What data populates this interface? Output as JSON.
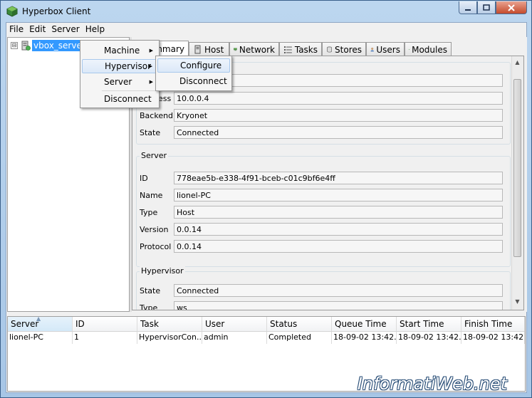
{
  "window": {
    "title": "Hyperbox Client"
  },
  "menubar": [
    {
      "label": "File",
      "name": "menu-file"
    },
    {
      "label": "Edit",
      "name": "menu-edit"
    },
    {
      "label": "Server",
      "name": "menu-server"
    },
    {
      "label": "Help",
      "name": "menu-help"
    }
  ],
  "tree": {
    "expander": "⊟",
    "server_label": "vbox_server"
  },
  "tabs": [
    {
      "label": "Summary",
      "name": "tab-summary",
      "icon": "summary-icon",
      "active": true
    },
    {
      "label": "Host",
      "name": "tab-host",
      "icon": "host-icon"
    },
    {
      "label": "Network",
      "name": "tab-network",
      "icon": "network-icon"
    },
    {
      "label": "Tasks",
      "name": "tab-tasks",
      "icon": "tasks-icon"
    },
    {
      "label": "Stores",
      "name": "tab-stores",
      "icon": "stores-icon"
    },
    {
      "label": "Users",
      "name": "tab-users",
      "icon": "users-icon"
    },
    {
      "label": "Modules",
      "name": "tab-modules",
      "icon": "modules-icon"
    }
  ],
  "summary": {
    "connection": {
      "address_label_partial": "ess",
      "address": "10.0.0.4",
      "backend_label": "Backend",
      "backend": "Kryonet",
      "state_label": "State",
      "state": "Connected"
    },
    "server": {
      "title": "Server",
      "id_label": "ID",
      "id": "778eae5b-e338-4f91-bceb-c01c9bf6e4ff",
      "name_label": "Name",
      "name": "lionel-PC",
      "type_label": "Type",
      "type": "Host",
      "version_label": "Version",
      "version": "0.0.14",
      "protocol_label": "Protocol",
      "protocol": "0.0.14"
    },
    "hypervisor": {
      "title": "Hypervisor",
      "state_label": "State",
      "state": "Connected",
      "type_label": "Type",
      "type": "ws"
    }
  },
  "context_menu": {
    "items": [
      {
        "label": "Machine",
        "submenu": true
      },
      {
        "label": "Hypervisor",
        "submenu": true,
        "highlighted": true
      },
      {
        "label": "Server",
        "submenu": true
      },
      {
        "label": "Disconnect",
        "submenu": false
      }
    ],
    "submenu_items": [
      {
        "label": "Configure",
        "highlighted": true
      },
      {
        "label": "Disconnect"
      }
    ]
  },
  "tasks_table": {
    "columns": [
      "Server",
      "ID",
      "Task",
      "User",
      "Status",
      "Queue Time",
      "Start Time",
      "Finish Time"
    ],
    "rows": [
      [
        "lionel-PC",
        "1",
        "HypervisorCon...",
        "admin",
        "Completed",
        "18-09-02 13:42...",
        "18-09-02 13:42...",
        "18-09-02 13:42..."
      ]
    ]
  },
  "watermark": "InformatiWeb.net",
  "colors": {
    "selection": "#3399ff",
    "title_gradient": "#a7c6e6"
  }
}
